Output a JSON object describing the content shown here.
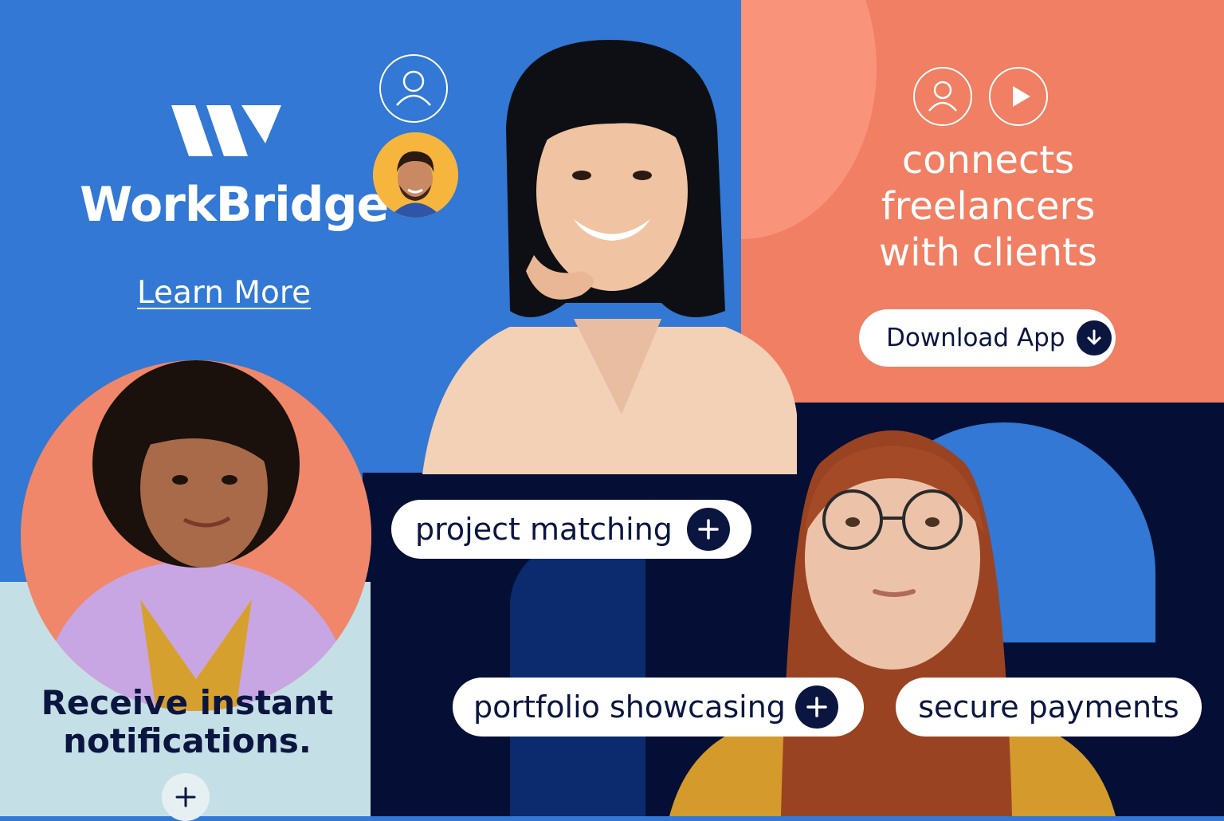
{
  "brand": {
    "name": "WorkBridge",
    "learn_more": "Learn More"
  },
  "hero": {
    "tagline": "connects freelancers with clients",
    "download_label": "Download App"
  },
  "features": {
    "project_matching": "project matching",
    "portfolio_showcasing": "portfolio showcasing",
    "secure_payments": "secure payments"
  },
  "notifications": {
    "text": "Receive instant notifications."
  },
  "icons": {
    "user": "user-icon",
    "play": "play-icon",
    "download": "download-arrow-icon",
    "plus": "plus-icon"
  },
  "colors": {
    "blue": "#3278d4",
    "coral": "#f07f63",
    "navy": "#050f35",
    "light_blue": "#c5dfe6",
    "ink": "#0b1640",
    "avatar_yellow": "#f6b53c"
  }
}
